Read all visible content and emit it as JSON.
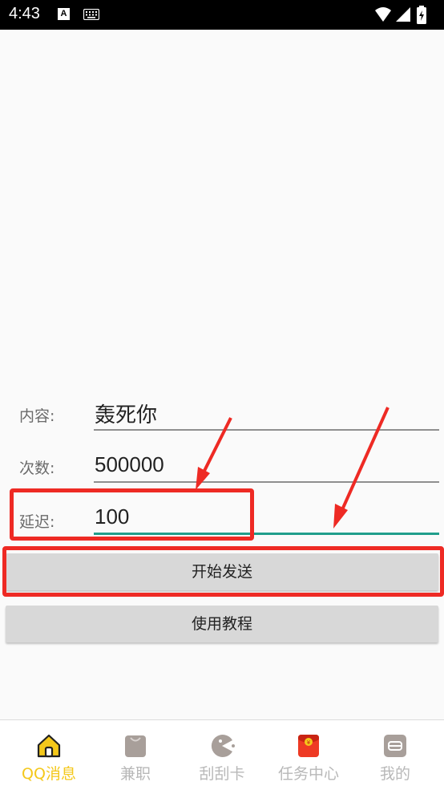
{
  "status_bar": {
    "time": "4:43",
    "notification_badge": "A",
    "icons": [
      "a-badge-icon",
      "keyboard-icon",
      "wifi-icon",
      "signal-icon",
      "battery-icon"
    ]
  },
  "form": {
    "content_label": "内容:",
    "content_value": "轰死你",
    "count_label": "次数:",
    "count_value": "500000",
    "delay_label": "延迟:",
    "delay_value": "100"
  },
  "buttons": {
    "start_send": "开始发送",
    "tutorial": "使用教程"
  },
  "tabs": [
    {
      "label": "QQ消息",
      "icon": "home-icon",
      "active": true
    },
    {
      "label": "兼职",
      "icon": "bag-icon",
      "active": false
    },
    {
      "label": "刮刮卡",
      "icon": "pacman-icon",
      "active": false
    },
    {
      "label": "任务中心",
      "icon": "red-envelope-icon",
      "active": false
    },
    {
      "label": "我的",
      "icon": "profile-card-icon",
      "active": false
    }
  ],
  "colors": {
    "accent_active_tab": "#f4c81b",
    "input_focus_line": "#1f9e8b",
    "annotation_red": "#ee2a24",
    "button_bg": "#d8d8d8"
  }
}
